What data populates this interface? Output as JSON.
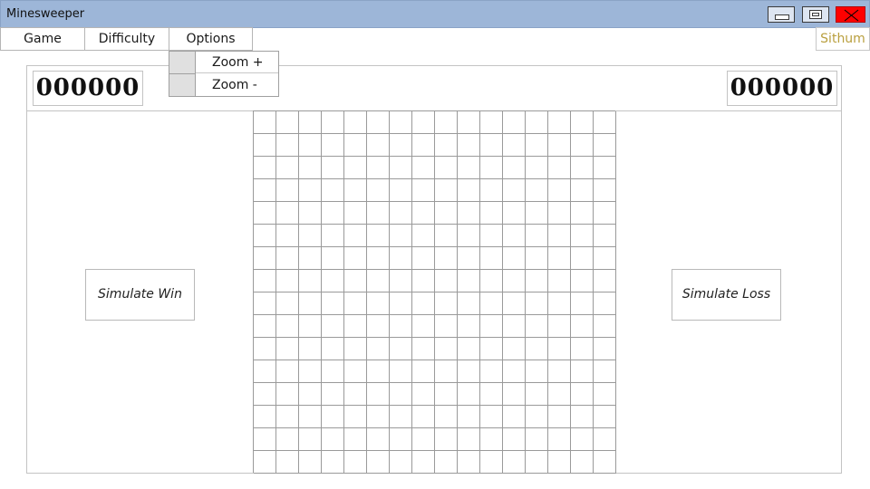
{
  "window": {
    "title": "Minesweeper",
    "controls": {
      "minimize_icon": "minimize-icon",
      "maximize_icon": "maximize-icon",
      "close_icon": "close-icon",
      "close_color": "#ff0000"
    },
    "titlebar_color": "#9db6d8"
  },
  "menu": {
    "game_label": "Game",
    "difficulty_label": "Difficulty",
    "options_label": "Options"
  },
  "options_menu": {
    "items": [
      {
        "label": "Zoom +"
      },
      {
        "label": "Zoom -"
      }
    ]
  },
  "user": {
    "name": "Sithum",
    "color": "#b99f3e"
  },
  "status": {
    "mine_counter": "000000",
    "timer": "000000"
  },
  "actions": {
    "simulate_win_label": "Simulate Win",
    "simulate_loss_label": "Simulate Loss"
  },
  "board": {
    "rows": 16,
    "columns": 16,
    "cell_state": "unrevealed"
  }
}
